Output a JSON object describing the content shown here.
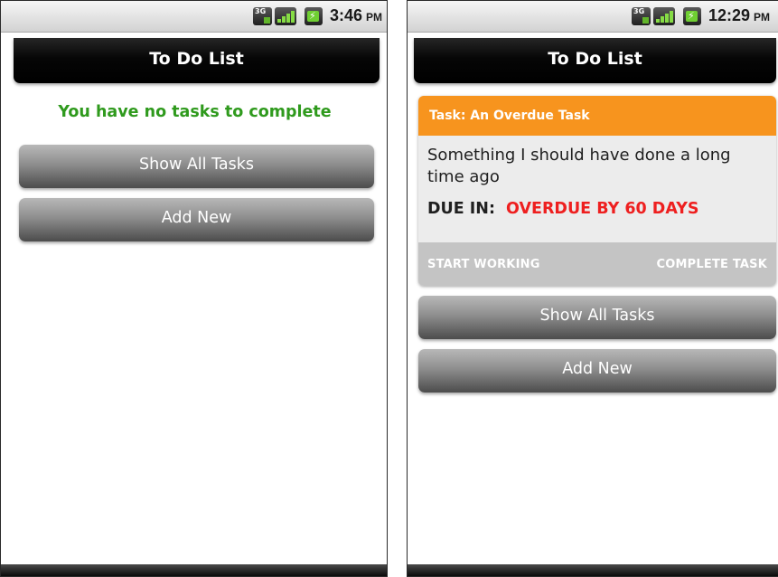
{
  "screens": [
    {
      "status_bar": {
        "network": "3G",
        "time": "3:46",
        "ampm": "PM"
      },
      "title": "To Do List",
      "empty_message": "You have no tasks to complete",
      "buttons": {
        "show_all": "Show All Tasks",
        "add_new": "Add New"
      }
    },
    {
      "status_bar": {
        "network": "3G",
        "time": "12:29",
        "ampm": "PM"
      },
      "title": "To Do List",
      "task": {
        "header": "Task: An Overdue Task",
        "description": "Something I should have done a long time ago",
        "due_label": "DUE IN:",
        "due_value": "OVERDUE BY 60 DAYS",
        "start_working": "START WORKING",
        "complete_task": "COMPLETE TASK"
      },
      "buttons": {
        "show_all": "Show All Tasks",
        "add_new": "Add New"
      }
    }
  ],
  "colors": {
    "empty_message": "#2f9a1d",
    "task_header": "#f7941e",
    "overdue": "#ee1f1f"
  },
  "icons": [
    "3g-icon",
    "signal-icon",
    "battery-icon"
  ]
}
